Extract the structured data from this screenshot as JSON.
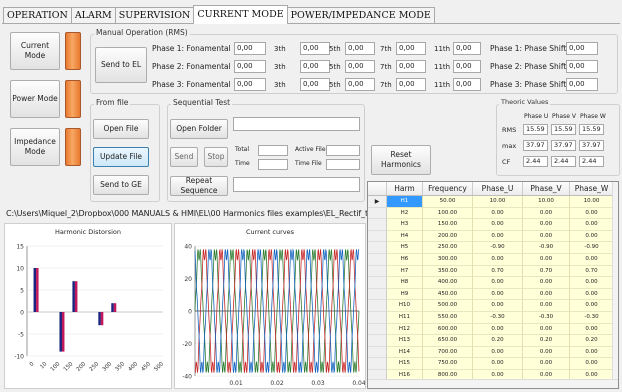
{
  "tabs": [
    "OPERATION",
    "ALARM",
    "SUPERVISION",
    "CURRENT MODE",
    "POWER/IMPEDANCE MODE"
  ],
  "mode_buttons": [
    "Current Mode",
    "Power Mode",
    "Impedance Mode"
  ],
  "manual_title": "Manual Operation (RMS)",
  "send_to_el": "Send to EL",
  "phase_labels": [
    "Phase 1: Fonamental",
    "Phase 2: Fonamental",
    "Phase 3: Fonamental"
  ],
  "harmonic_labels": [
    "3th",
    "5th",
    "7th",
    "11th"
  ],
  "zero": "0,00",
  "shift_labels": [
    "Phase 1: Phase Shift",
    "Phase 2: Phase Shift",
    "Phase 3: Phase Shift"
  ],
  "from_file_title": "From file",
  "open_file": "Open File",
  "update_file": "Update File",
  "send_to_ge": "Send to GE",
  "seq_title": "Sequential Test",
  "open_folder": "Open Folder",
  "send": "Send",
  "stop": "Stop",
  "total": "Total",
  "time": "Time",
  "active_file": "Active File",
  "time_file": "Time File",
  "repeat_seq": "Repeat Sequence",
  "reset_harm": "Reset Harmonics",
  "path": "C:\\Users\\Miquel_2\\Dropbox\\000 MANUALS & HMI\\EL\\00 Harmonics files examples\\EL_Rectif_trif.xls",
  "theoric": {
    "title": "Theoric Values",
    "cols": [
      "Phase U",
      "Phase V",
      "Phase W"
    ],
    "rows": [
      {
        "label": "RMS",
        "vals": [
          "15.59",
          "15.59",
          "15.59"
        ]
      },
      {
        "label": "max",
        "vals": [
          "37.97",
          "37.97",
          "37.97"
        ]
      },
      {
        "label": "CF",
        "vals": [
          "2.44",
          "2.44",
          "2.44"
        ]
      }
    ]
  },
  "grid": {
    "headers": [
      "Harm",
      "Frequency",
      "Phase_U",
      "Phase_V",
      "Phase_W"
    ],
    "rows": [
      [
        "H1",
        "50.00",
        "10.00",
        "10.00",
        "10.00"
      ],
      [
        "H2",
        "100.00",
        "0.00",
        "0.00",
        "0.00"
      ],
      [
        "H3",
        "150.00",
        "0.00",
        "0.00",
        "0.00"
      ],
      [
        "H4",
        "200.00",
        "0.00",
        "0.00",
        "0.00"
      ],
      [
        "H5",
        "250.00",
        "-0.90",
        "-0.90",
        "-0.90"
      ],
      [
        "H6",
        "300.00",
        "0.00",
        "0.00",
        "0.00"
      ],
      [
        "H7",
        "350.00",
        "0.70",
        "0.70",
        "0.70"
      ],
      [
        "H8",
        "400.00",
        "0.00",
        "0.00",
        "0.00"
      ],
      [
        "H9",
        "450.00",
        "0.00",
        "0.00",
        "0.00"
      ],
      [
        "H10",
        "500.00",
        "0.00",
        "0.00",
        "0.00"
      ],
      [
        "H11",
        "550.00",
        "-0.30",
        "-0.30",
        "-0.30"
      ],
      [
        "H12",
        "600.00",
        "0.00",
        "0.00",
        "0.00"
      ],
      [
        "H13",
        "650.00",
        "0.20",
        "0.20",
        "0.20"
      ],
      [
        "H14",
        "700.00",
        "0.00",
        "0.00",
        "0.00"
      ],
      [
        "H15",
        "750.00",
        "0.00",
        "0.00",
        "0.00"
      ],
      [
        "H16",
        "800.00",
        "0.00",
        "0.00",
        "0.00"
      ]
    ]
  },
  "chart_data": [
    {
      "type": "bar",
      "title": "Harmonic Distorsion",
      "ylim": [
        -10,
        15
      ],
      "yticks": [
        "15",
        "10",
        "5",
        "0",
        "-5",
        "-10"
      ],
      "categories": [
        "H1",
        "H3",
        "H5",
        "H7",
        "H9",
        "H11",
        "H13",
        "H15",
        "H17",
        "H19"
      ],
      "xticklabels": [
        "0",
        "10",
        "100",
        "150",
        "200",
        "250",
        "300",
        "350",
        "400",
        "450",
        "500"
      ],
      "series": [
        {
          "values": [
            10,
            0,
            -9,
            7,
            0,
            -3,
            2,
            0,
            0,
            0
          ]
        }
      ]
    },
    {
      "type": "line",
      "title": "Current curves",
      "xlim": [
        0,
        0.04
      ],
      "ylim": [
        -40,
        40
      ],
      "yticks": [
        "40",
        "20",
        "0",
        "-20",
        "-40"
      ],
      "xticks": [
        "0.01",
        "0.02",
        "0.03",
        "0.04"
      ],
      "series": [
        {
          "color": "#2e7d32"
        },
        {
          "color": "#c62828"
        },
        {
          "color": "#1565c0"
        }
      ]
    }
  ]
}
